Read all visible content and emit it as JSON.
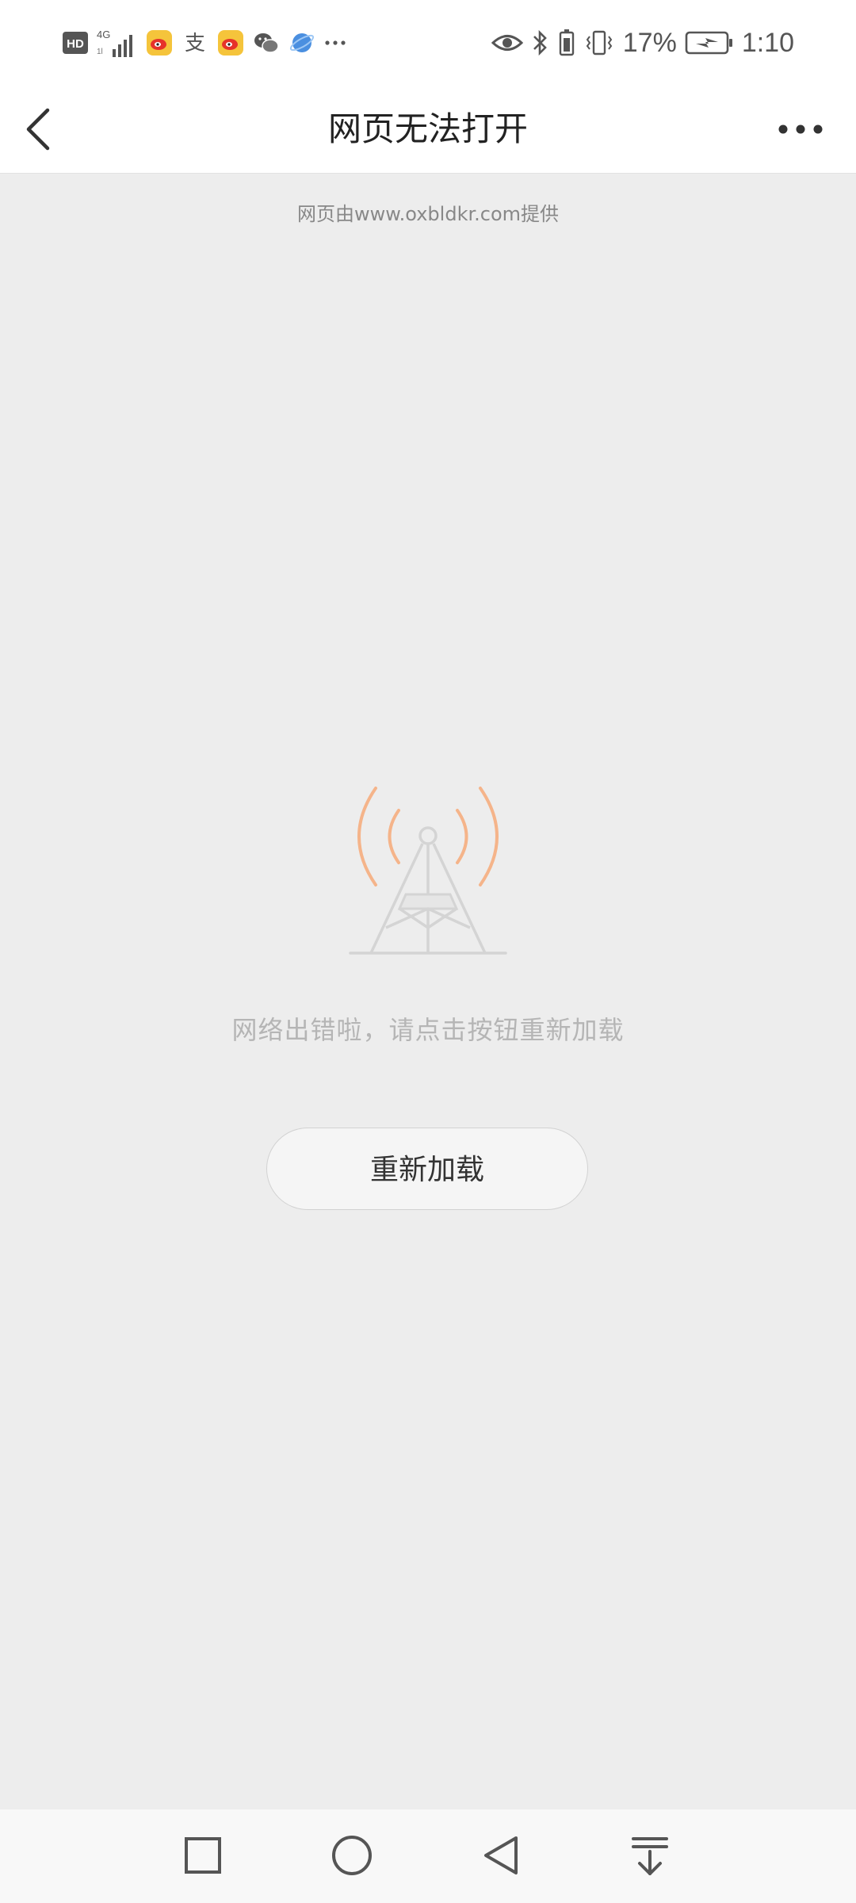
{
  "status_bar": {
    "battery_percent": "17%",
    "time": "1:10",
    "left_icons": [
      "hd-icon",
      "signal-4g-icon",
      "weibo-icon",
      "alipay-icon",
      "weibo-icon",
      "wechat-icon",
      "browser-icon",
      "more-dots-icon"
    ],
    "right_icons": [
      "eye-icon",
      "bluetooth-icon",
      "battery-saver-icon",
      "vibrate-icon",
      "battery-charging-icon"
    ]
  },
  "header": {
    "title": "网页无法打开"
  },
  "content": {
    "provider_text": "网页由www.oxbldkr.com提供",
    "error_message": "网络出错啦，请点击按钮重新加载",
    "reload_label": "重新加载"
  },
  "colors": {
    "accent_waves": "#f5b48a",
    "tower": "#d4d4d4",
    "background": "#ededed"
  }
}
